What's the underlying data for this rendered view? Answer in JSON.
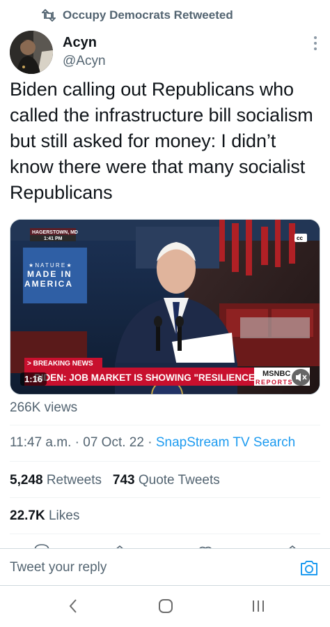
{
  "retweet_context": {
    "icon": "retweet-icon",
    "text": "Occupy Democrats Retweeted"
  },
  "author": {
    "name": "Acyn",
    "handle": "@Acyn",
    "avatar": "avatar-image"
  },
  "tweet": {
    "text": "Biden calling out Republicans who called the infrastructure bill socialism but still asked for money: I didn’t know there were that many socialist Republicans"
  },
  "video": {
    "duration": "1:16",
    "overlay": {
      "location": "HAGERSTOWN, MD",
      "time": "1:41 PM",
      "banner_line1": "MADE IN",
      "banner_line2": "AMERICA",
      "cc": "cc",
      "breaking_tag": "> BREAKING NEWS",
      "chyron": "BIDEN: JOB MARKET IS SHOWING \"RESILIENCE\"",
      "network": "MSNBC",
      "network_sub": "REPORTS"
    }
  },
  "views": "266K views",
  "meta": {
    "time": "11:47 a.m.",
    "sep1": " · ",
    "date": "07 Oct. 22",
    "sep2": " · ",
    "source": "SnapStream TV Search"
  },
  "stats": {
    "retweets_count": "5,248",
    "retweets_label": "Retweets",
    "quotes_count": "743",
    "quotes_label": "Quote Tweets",
    "likes_count": "22.7K",
    "likes_label": "Likes"
  },
  "reply": {
    "placeholder": "Tweet your reply",
    "camera_icon": "camera-icon"
  },
  "navbar": {
    "back": "back-icon",
    "home": "home-icon",
    "recents": "recents-icon"
  },
  "colors": {
    "accent": "#1d9bf0",
    "text": "#0f1419",
    "secondary": "#536471",
    "msnbc_red": "#c8102e"
  }
}
